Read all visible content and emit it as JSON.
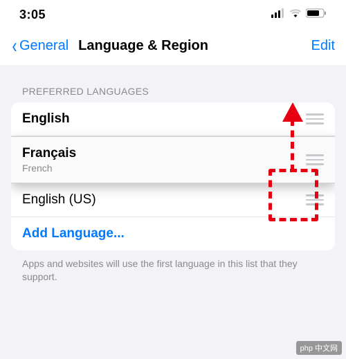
{
  "status": {
    "time": "3:05"
  },
  "nav": {
    "back_label": "General",
    "title": "Language & Region",
    "edit_label": "Edit"
  },
  "section": {
    "header": "PREFERRED LANGUAGES",
    "languages": [
      {
        "title": "English",
        "subtitle": null
      },
      {
        "title": "Français",
        "subtitle": "French"
      },
      {
        "title": "English (US)",
        "subtitle": null
      }
    ],
    "add_label": "Add Language...",
    "footer": "Apps and websites will use the first language in this list that they support."
  },
  "watermark": "php 中文网"
}
